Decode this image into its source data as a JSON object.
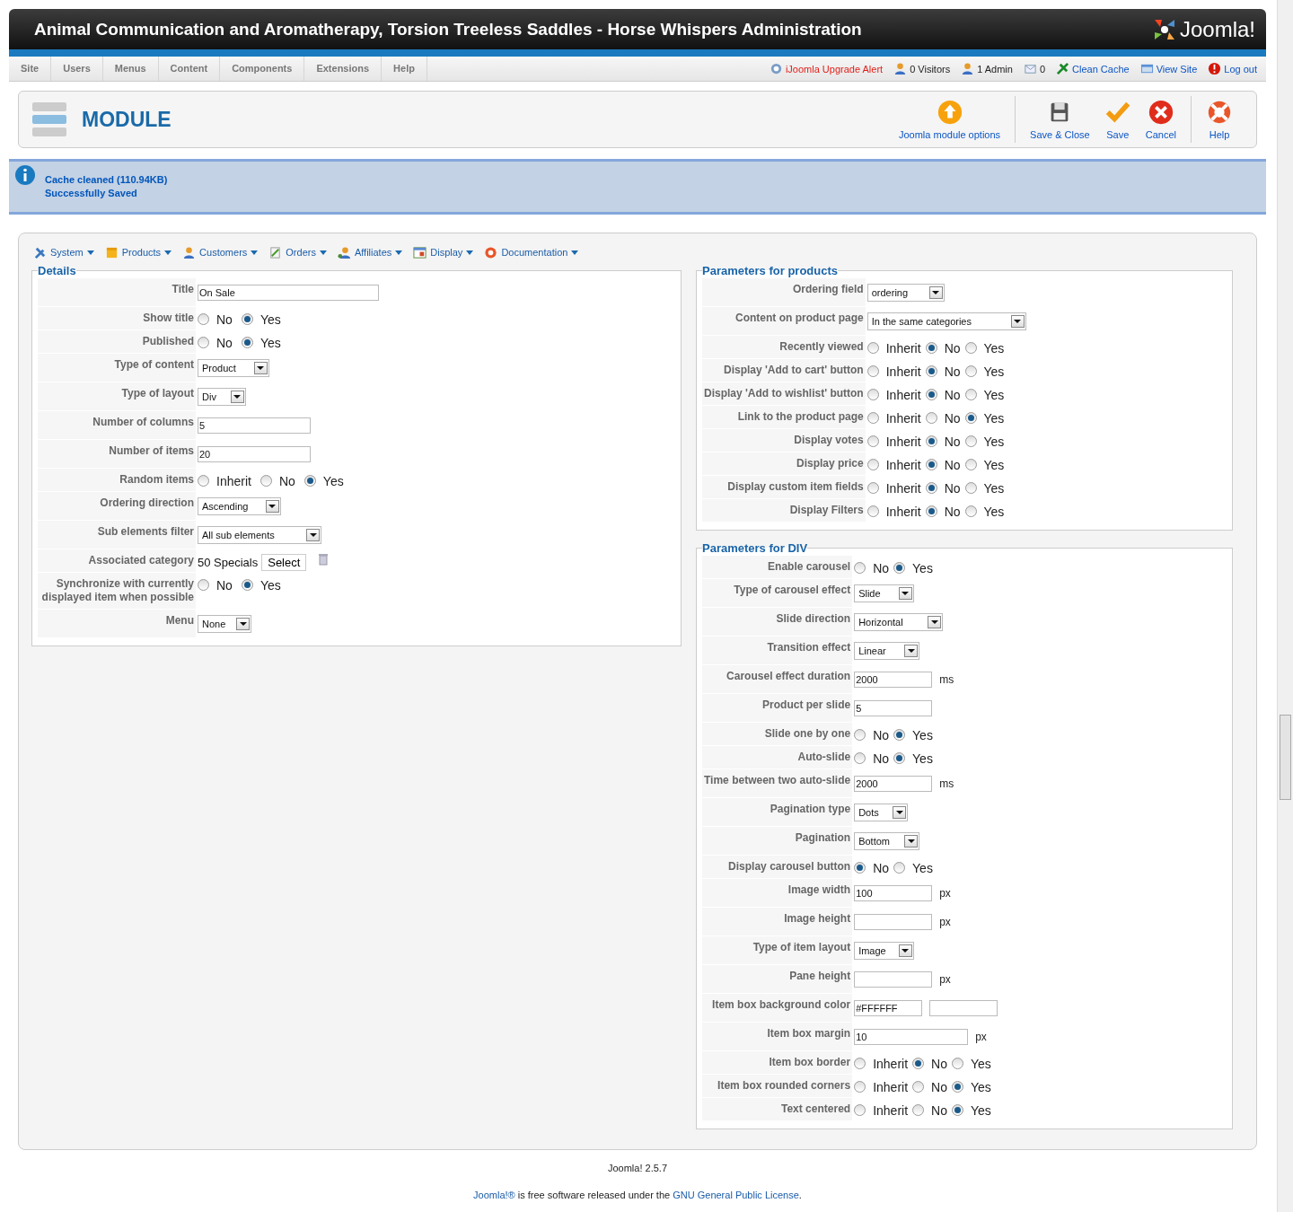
{
  "header": {
    "title": "Animal Communication and Aromatherapy, Torsion Treeless Saddles - Horse Whispers Administration",
    "logo": "Joomla!"
  },
  "menu": [
    "Site",
    "Users",
    "Menus",
    "Content",
    "Components",
    "Extensions",
    "Help"
  ],
  "status": [
    {
      "kind": "alert",
      "label": "iJoomla Upgrade Alert"
    },
    {
      "kind": "visitors",
      "label": "0 Visitors"
    },
    {
      "kind": "admins",
      "label": "1 Admin"
    },
    {
      "kind": "messages",
      "label": "0"
    },
    {
      "kind": "cache",
      "label": "Clean Cache"
    },
    {
      "kind": "site",
      "label": "View Site"
    },
    {
      "kind": "logout",
      "label": "Log out"
    }
  ],
  "toolbar": {
    "title": "MODULE",
    "button_groups": [
      [
        {
          "kind": "options",
          "label": "Joomla module options"
        }
      ],
      [
        {
          "kind": "save-close",
          "label": "Save & Close"
        },
        {
          "kind": "save",
          "label": "Save"
        },
        {
          "kind": "cancel",
          "label": "Cancel"
        }
      ],
      [
        {
          "kind": "help",
          "label": "Help"
        }
      ]
    ]
  },
  "messages": [
    "Cache cleaned (110.94KB)",
    "Successfully Saved"
  ],
  "component_menu": [
    {
      "kind": "system",
      "label": "System"
    },
    {
      "kind": "products",
      "label": "Products"
    },
    {
      "kind": "customers",
      "label": "Customers"
    },
    {
      "kind": "orders",
      "label": "Orders"
    },
    {
      "kind": "affiliates",
      "label": "Affiliates"
    },
    {
      "kind": "display",
      "label": "Display"
    },
    {
      "kind": "documentation",
      "label": "Documentation"
    }
  ],
  "details": {
    "legend": "Details",
    "fields": [
      {
        "label": "Title",
        "kind": "text",
        "value": "On Sale"
      },
      {
        "label": "Show title",
        "kind": "radio",
        "options": [
          {
            "label": "No",
            "selected": false
          },
          {
            "label": "Yes",
            "selected": true
          }
        ]
      },
      {
        "label": "Published",
        "kind": "radio",
        "options": [
          {
            "label": "No",
            "selected": false
          },
          {
            "label": "Yes",
            "selected": true
          }
        ]
      },
      {
        "label": "Type of content",
        "kind": "select",
        "value": "Product"
      },
      {
        "label": "Type of layout",
        "kind": "select",
        "value": "Div"
      },
      {
        "label": "Number of columns",
        "kind": "text",
        "value": "5"
      },
      {
        "label": "Number of items",
        "kind": "text",
        "value": "20"
      },
      {
        "label": "Random items",
        "kind": "radio",
        "options": [
          {
            "label": "Inherit",
            "selected": false
          },
          {
            "label": "No",
            "selected": false
          },
          {
            "label": "Yes",
            "selected": true
          }
        ]
      },
      {
        "label": "Ordering direction",
        "kind": "select",
        "value": "Ascending"
      },
      {
        "label": "Sub elements filter",
        "kind": "select",
        "value": "All sub elements"
      },
      {
        "label": "Associated category",
        "kind": "category",
        "value": "50 Specials",
        "button": "Select"
      },
      {
        "label": "Synchronize with currently displayed item when possible",
        "kind": "radio",
        "options": [
          {
            "label": "No",
            "selected": false
          },
          {
            "label": "Yes",
            "selected": true
          }
        ]
      },
      {
        "label": "Menu",
        "kind": "select",
        "value": "None"
      }
    ]
  },
  "products": {
    "legend": "Parameters for products",
    "fields": [
      {
        "label": "Ordering field",
        "kind": "select",
        "value": "ordering"
      },
      {
        "label": "Content on product page",
        "kind": "select",
        "value": "In the same categories"
      },
      {
        "label": "Recently viewed",
        "kind": "radio",
        "options": [
          {
            "label": "Inherit",
            "selected": false
          },
          {
            "label": "No",
            "selected": true
          },
          {
            "label": "Yes",
            "selected": false
          }
        ]
      },
      {
        "label": "Display 'Add to cart' button",
        "kind": "radio",
        "options": [
          {
            "label": "Inherit",
            "selected": false
          },
          {
            "label": "No",
            "selected": true
          },
          {
            "label": "Yes",
            "selected": false
          }
        ]
      },
      {
        "label": "Display 'Add to wishlist' button",
        "kind": "radio",
        "options": [
          {
            "label": "Inherit",
            "selected": false
          },
          {
            "label": "No",
            "selected": true
          },
          {
            "label": "Yes",
            "selected": false
          }
        ]
      },
      {
        "label": "Link to the product page",
        "kind": "radio",
        "options": [
          {
            "label": "Inherit",
            "selected": false
          },
          {
            "label": "No",
            "selected": false
          },
          {
            "label": "Yes",
            "selected": true
          }
        ]
      },
      {
        "label": "Display votes",
        "kind": "radio",
        "options": [
          {
            "label": "Inherit",
            "selected": false
          },
          {
            "label": "No",
            "selected": true
          },
          {
            "label": "Yes",
            "selected": false
          }
        ]
      },
      {
        "label": "Display price",
        "kind": "radio",
        "options": [
          {
            "label": "Inherit",
            "selected": false
          },
          {
            "label": "No",
            "selected": true
          },
          {
            "label": "Yes",
            "selected": false
          }
        ]
      },
      {
        "label": "Display custom item fields",
        "kind": "radio",
        "options": [
          {
            "label": "Inherit",
            "selected": false
          },
          {
            "label": "No",
            "selected": true
          },
          {
            "label": "Yes",
            "selected": false
          }
        ]
      },
      {
        "label": "Display Filters",
        "kind": "radio",
        "options": [
          {
            "label": "Inherit",
            "selected": false
          },
          {
            "label": "No",
            "selected": true
          },
          {
            "label": "Yes",
            "selected": false
          }
        ]
      }
    ]
  },
  "div": {
    "legend": "Parameters for DIV",
    "fields": [
      {
        "label": "Enable carousel",
        "kind": "radio",
        "options": [
          {
            "label": "No",
            "selected": false
          },
          {
            "label": "Yes",
            "selected": true
          }
        ]
      },
      {
        "label": "Type of carousel effect",
        "kind": "select",
        "value": "Slide"
      },
      {
        "label": "Slide direction",
        "kind": "select",
        "value": "Horizontal"
      },
      {
        "label": "Transition effect",
        "kind": "select",
        "value": "Linear"
      },
      {
        "label": "Carousel effect duration",
        "kind": "text",
        "value": "2000",
        "unit": "ms"
      },
      {
        "label": "Product per slide",
        "kind": "text",
        "value": "5"
      },
      {
        "label": "Slide one by one",
        "kind": "radio",
        "options": [
          {
            "label": "No",
            "selected": false
          },
          {
            "label": "Yes",
            "selected": true
          }
        ]
      },
      {
        "label": "Auto-slide",
        "kind": "radio",
        "options": [
          {
            "label": "No",
            "selected": false
          },
          {
            "label": "Yes",
            "selected": true
          }
        ]
      },
      {
        "label": "Time between two auto-slide",
        "kind": "text",
        "value": "2000",
        "unit": "ms"
      },
      {
        "label": "Pagination type",
        "kind": "select",
        "value": "Dots"
      },
      {
        "label": "Pagination",
        "kind": "select",
        "value": "Bottom"
      },
      {
        "label": "Display carousel button",
        "kind": "radio",
        "options": [
          {
            "label": "No",
            "selected": true
          },
          {
            "label": "Yes",
            "selected": false
          }
        ]
      },
      {
        "label": "Image width",
        "kind": "text",
        "value": "100",
        "unit": "px"
      },
      {
        "label": "Image height",
        "kind": "text",
        "unit": "px"
      },
      {
        "label": "Type of item layout",
        "kind": "select",
        "value": "Image"
      },
      {
        "label": "Pane height",
        "kind": "text",
        "unit": "px"
      },
      {
        "label": "Item box background color",
        "kind": "color",
        "value": "#FFFFFF"
      },
      {
        "label": "Item box margin",
        "kind": "text",
        "value": "10",
        "unit": "px"
      },
      {
        "label": "Item box border",
        "kind": "radio",
        "options": [
          {
            "label": "Inherit",
            "selected": false
          },
          {
            "label": "No",
            "selected": true
          },
          {
            "label": "Yes",
            "selected": false
          }
        ]
      },
      {
        "label": "Item box rounded corners",
        "kind": "radio",
        "options": [
          {
            "label": "Inherit",
            "selected": false
          },
          {
            "label": "No",
            "selected": false
          },
          {
            "label": "Yes",
            "selected": true
          }
        ]
      },
      {
        "label": "Text centered",
        "kind": "radio",
        "options": [
          {
            "label": "Inherit",
            "selected": false
          },
          {
            "label": "No",
            "selected": false
          },
          {
            "label": "Yes",
            "selected": true
          }
        ]
      }
    ]
  },
  "footer": {
    "version": "Joomla! 2.5.7",
    "license": {
      "link": "Joomla!®",
      "text": " is free software released under the ",
      "link2": "GNU General Public License",
      "end": "."
    }
  }
}
